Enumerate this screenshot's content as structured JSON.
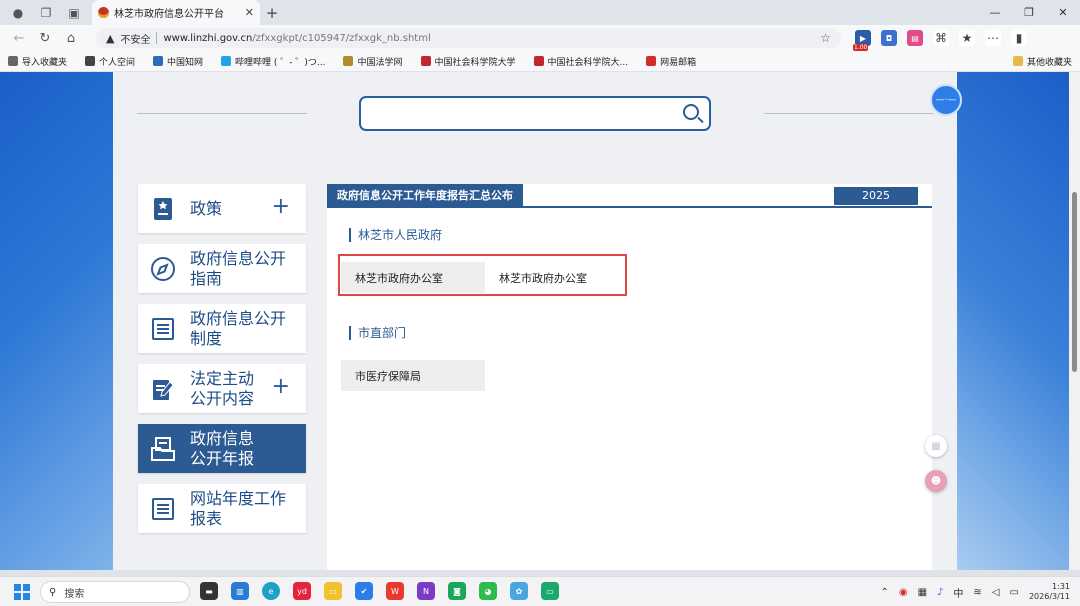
{
  "browser": {
    "tab_title": "林芝市政府信息公开平台",
    "address": {
      "security_label": "不安全",
      "url_host": "www.linzhi.gov.cn",
      "url_path": "/zfxxgkpt/c105947/zfxxgk_nb.shtml"
    },
    "extension_badge": "1.00",
    "bookmarks": [
      {
        "label": "导入收藏夹",
        "icon": "import-icon",
        "color": "#666666"
      },
      {
        "label": "个人空间",
        "icon": "globe-icon",
        "color": "#444444"
      },
      {
        "label": "中国知网",
        "icon": "cnki-icon",
        "color": "#2c6bb5"
      },
      {
        "label": "哔哩哔哩 ( ゜- ゜)つ...",
        "icon": "bilibili-icon",
        "color": "#22a3e3"
      },
      {
        "label": "中国法学网",
        "icon": "law-icon",
        "color": "#b38a2a"
      },
      {
        "label": "中国社会科学院大学",
        "icon": "cass-icon",
        "color": "#c0282d"
      },
      {
        "label": "中国社会科学院大...",
        "icon": "cass-icon",
        "color": "#c0282d"
      },
      {
        "label": "网易邮箱",
        "icon": "mail-icon",
        "color": "#d22e2e"
      }
    ],
    "other_bookmarks": "其他收藏夹"
  },
  "page": {
    "search": {
      "placeholder": ""
    },
    "menu": [
      {
        "label": "政策",
        "icon": "policy-document-icon",
        "has_plus": true,
        "active": false
      },
      {
        "label": "政府信息公开\n指南",
        "icon": "compass-icon",
        "has_plus": false,
        "active": false
      },
      {
        "label": "政府信息公开\n制度",
        "icon": "list-document-icon",
        "has_plus": false,
        "active": false
      },
      {
        "label": "法定主动\n公开内容",
        "icon": "edit-document-icon",
        "has_plus": true,
        "active": false
      },
      {
        "label": "政府信息\n公开年报",
        "icon": "report-folder-icon",
        "has_plus": false,
        "active": true
      },
      {
        "label": "网站年度工作\n报表",
        "icon": "list-document-icon",
        "has_plus": false,
        "active": false
      }
    ],
    "content": {
      "header_title": "政府信息公开工作年度报告汇总公布",
      "year": "2025",
      "section1_title": "林芝市人民政府",
      "section1_items": [
        "林芝市政府办公室",
        "林芝市政府办公室"
      ],
      "section2_title": "市直部门",
      "section2_items": [
        "市医疗保障局"
      ]
    }
  },
  "taskbar": {
    "search_label": "搜索",
    "ime": "中",
    "time": "1:31",
    "date": "2026/3/11"
  },
  "colors": {
    "brand_blue": "#2c5b93",
    "highlight_red": "#e04646"
  }
}
